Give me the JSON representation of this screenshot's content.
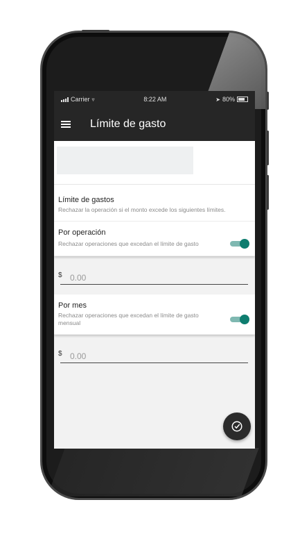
{
  "status_bar": {
    "carrier": "Carrier",
    "time": "8:22 AM",
    "battery": "80%"
  },
  "app_bar": {
    "title": "Límite de gasto",
    "menu_icon": "hamburger-icon"
  },
  "spending_limits": {
    "title": "Límite de gastos",
    "description": "Rechazar la operación si el monto excede los siguientes límites."
  },
  "per_operation": {
    "title": "Por operación",
    "description": "Rechazar operaciones que excedan el límite de gasto",
    "enabled": true,
    "currency": "$",
    "placeholder": "0.00"
  },
  "per_month": {
    "title": "Por mes",
    "description": "Rechazar operaciones que excedan el límite de gasto mensual",
    "enabled": true,
    "currency": "$",
    "placeholder": "0.00"
  },
  "fab": {
    "icon": "check-circle-icon"
  },
  "colors": {
    "accent": "#0e7d6f",
    "appbar": "#262626"
  }
}
